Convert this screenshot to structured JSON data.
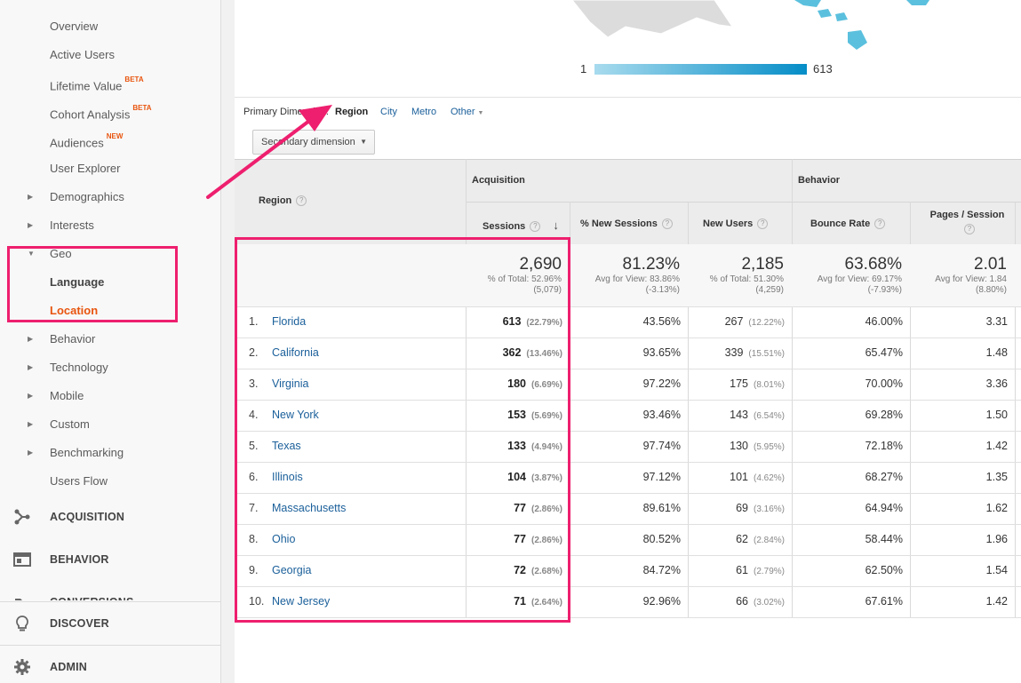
{
  "sidebar": {
    "items": [
      {
        "label": "Overview",
        "badge": ""
      },
      {
        "label": "Active Users",
        "badge": ""
      },
      {
        "label": "Lifetime Value",
        "badge": "BETA"
      },
      {
        "label": "Cohort Analysis",
        "badge": "BETA"
      },
      {
        "label": "Audiences",
        "badge": "NEW"
      },
      {
        "label": "User Explorer",
        "badge": ""
      }
    ],
    "groups": [
      "Demographics",
      "Interests",
      "Geo"
    ],
    "geo_children": [
      "Language",
      "Location"
    ],
    "more_groups": [
      "Behavior",
      "Technology",
      "Mobile",
      "Custom",
      "Benchmarking"
    ],
    "users_flow": "Users Flow",
    "sections": [
      "ACQUISITION",
      "BEHAVIOR",
      "CONVERSIONS",
      "DISCOVER",
      "ADMIN"
    ]
  },
  "map_legend": {
    "min": "1",
    "max": "613"
  },
  "dimension_bar": {
    "label": "Primary Dimension:",
    "selected": "Region",
    "options": [
      "City",
      "Metro",
      "Other"
    ]
  },
  "secondary_dimension": "Secondary dimension",
  "table": {
    "region_header": "Region",
    "group_acquisition": "Acquisition",
    "group_behavior": "Behavior",
    "columns": [
      "Sessions",
      "% New Sessions",
      "New Users",
      "Bounce Rate",
      "Pages / Session"
    ],
    "totals": {
      "sessions": {
        "value": "2,690",
        "line1": "% of Total: 52.96%",
        "line2": "(5,079)"
      },
      "new_sessions": {
        "value": "81.23%",
        "line1": "Avg for View: 83.86%",
        "line2": "(-3.13%)"
      },
      "new_users": {
        "value": "2,185",
        "line1": "% of Total: 51.30%",
        "line2": "(4,259)"
      },
      "bounce": {
        "value": "63.68%",
        "line1": "Avg for View: 69.17%",
        "line2": "(-7.93%)"
      },
      "pages": {
        "value": "2.01",
        "line1": "Avg for View: 1.84",
        "line2": "(8.80%)"
      }
    },
    "rows": [
      {
        "n": "1.",
        "region": "Florida",
        "sessions": "613",
        "sessions_pct": "(22.79%)",
        "new_sessions": "43.56%",
        "new_users": "267",
        "new_users_pct": "(12.22%)",
        "bounce": "46.00%",
        "pages": "3.31"
      },
      {
        "n": "2.",
        "region": "California",
        "sessions": "362",
        "sessions_pct": "(13.46%)",
        "new_sessions": "93.65%",
        "new_users": "339",
        "new_users_pct": "(15.51%)",
        "bounce": "65.47%",
        "pages": "1.48"
      },
      {
        "n": "3.",
        "region": "Virginia",
        "sessions": "180",
        "sessions_pct": "(6.69%)",
        "new_sessions": "97.22%",
        "new_users": "175",
        "new_users_pct": "(8.01%)",
        "bounce": "70.00%",
        "pages": "3.36"
      },
      {
        "n": "4.",
        "region": "New York",
        "sessions": "153",
        "sessions_pct": "(5.69%)",
        "new_sessions": "93.46%",
        "new_users": "143",
        "new_users_pct": "(6.54%)",
        "bounce": "69.28%",
        "pages": "1.50"
      },
      {
        "n": "5.",
        "region": "Texas",
        "sessions": "133",
        "sessions_pct": "(4.94%)",
        "new_sessions": "97.74%",
        "new_users": "130",
        "new_users_pct": "(5.95%)",
        "bounce": "72.18%",
        "pages": "1.42"
      },
      {
        "n": "6.",
        "region": "Illinois",
        "sessions": "104",
        "sessions_pct": "(3.87%)",
        "new_sessions": "97.12%",
        "new_users": "101",
        "new_users_pct": "(4.62%)",
        "bounce": "68.27%",
        "pages": "1.35"
      },
      {
        "n": "7.",
        "region": "Massachusetts",
        "sessions": "77",
        "sessions_pct": "(2.86%)",
        "new_sessions": "89.61%",
        "new_users": "69",
        "new_users_pct": "(3.16%)",
        "bounce": "64.94%",
        "pages": "1.62"
      },
      {
        "n": "8.",
        "region": "Ohio",
        "sessions": "77",
        "sessions_pct": "(2.86%)",
        "new_sessions": "80.52%",
        "new_users": "62",
        "new_users_pct": "(2.84%)",
        "bounce": "58.44%",
        "pages": "1.96"
      },
      {
        "n": "9.",
        "region": "Georgia",
        "sessions": "72",
        "sessions_pct": "(2.68%)",
        "new_sessions": "84.72%",
        "new_users": "61",
        "new_users_pct": "(2.79%)",
        "bounce": "62.50%",
        "pages": "1.54"
      },
      {
        "n": "10.",
        "region": "New Jersey",
        "sessions": "71",
        "sessions_pct": "(2.64%)",
        "new_sessions": "92.96%",
        "new_users": "66",
        "new_users_pct": "(3.02%)",
        "bounce": "67.61%",
        "pages": "1.42"
      }
    ]
  },
  "colors": {
    "highlight": "#ee1f6e",
    "link": "#1a5f9a",
    "active": "#e8550f",
    "map_fill": "#5bc0de"
  }
}
